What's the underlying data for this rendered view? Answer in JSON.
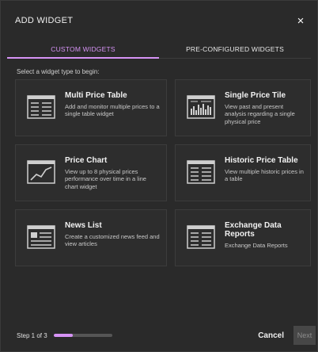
{
  "dialog": {
    "title": "ADD WIDGET",
    "close_icon": "×"
  },
  "tabs": [
    {
      "label": "CUSTOM WIDGETS",
      "active": true
    },
    {
      "label": "PRE-CONFIGURED WIDGETS",
      "active": false
    }
  ],
  "instruction": "Select a widget type to begin:",
  "widgets": [
    {
      "title": "Multi Price Table",
      "description": "Add and monitor multiple prices to a single table widget",
      "icon": "table-icon"
    },
    {
      "title": "Single Price Tile",
      "description": "View past and present analysis regarding a single physical price",
      "icon": "tile-icon"
    },
    {
      "title": "Price Chart",
      "description": "View up to 8 physical prices performance over time in a line chart widget",
      "icon": "line-chart-icon"
    },
    {
      "title": "Historic Price Table",
      "description": "View multiple historic prices in a table",
      "icon": "table-icon"
    },
    {
      "title": "News List",
      "description": "Create a customized news feed and view articles",
      "icon": "news-icon"
    },
    {
      "title": "Exchange Data Reports",
      "description": "Exchange Data Reports",
      "icon": "table-icon"
    }
  ],
  "footer": {
    "step_label": "Step 1 of 3",
    "progress": 0.33,
    "cancel_label": "Cancel",
    "next_label": "Next"
  },
  "colors": {
    "accent": "#d693f5",
    "background": "#2a2a2a",
    "card_border": "#3c3c3c"
  }
}
